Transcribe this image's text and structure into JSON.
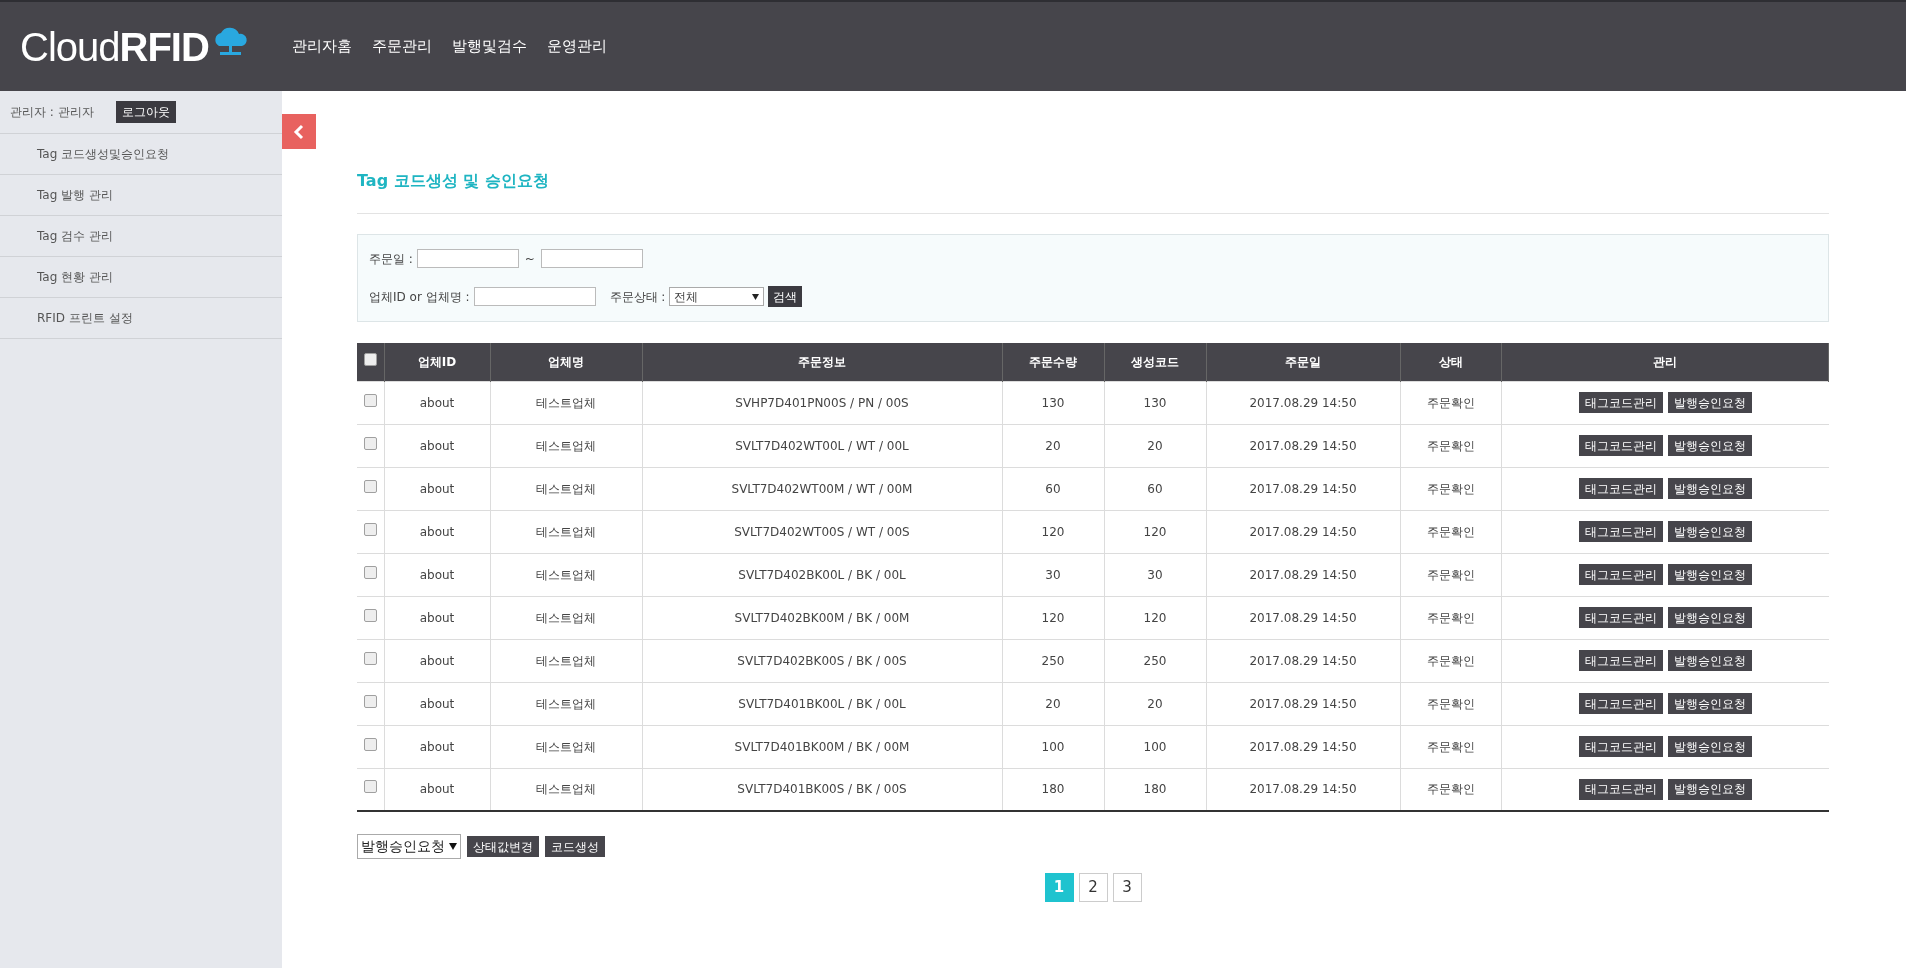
{
  "header": {
    "logo_light": "Cloud",
    "logo_bold": "RFID",
    "nav": [
      {
        "label": "관리자홈"
      },
      {
        "label": "주문관리"
      },
      {
        "label": "발행및검수"
      },
      {
        "label": "운영관리"
      }
    ]
  },
  "sidebar": {
    "user": "관리자 : 관리자",
    "logout": "로그아웃",
    "items": [
      {
        "label": "Tag 코드생성및승인요청"
      },
      {
        "label": "Tag 발행 관리"
      },
      {
        "label": "Tag 검수 관리"
      },
      {
        "label": "Tag 현황 관리"
      },
      {
        "label": "RFID 프린트 설정"
      }
    ]
  },
  "page_title": "Tag 코드생성 및 승인요청",
  "filters": {
    "date_label": "주문일 :",
    "date_separator": "~",
    "company_label": "업체ID or 업체명 :",
    "status_label": "주문상태 :",
    "status_value": "전체",
    "search_button": "검색"
  },
  "table": {
    "select_all_checked": false,
    "columns": [
      "업체ID",
      "업체명",
      "주문정보",
      "주문수량",
      "생성코드",
      "주문일",
      "상태",
      "관리"
    ],
    "rows": [
      {
        "checked": false,
        "cells": [
          "about",
          "테스트업체",
          "SVHP7D401PN00S / PN / 00S",
          "130",
          "130",
          "2017.08.29 14:50",
          "주문확인"
        ],
        "buttons": [
          "태그코드관리",
          "발행승인요청"
        ]
      },
      {
        "checked": false,
        "cells": [
          "about",
          "테스트업체",
          "SVLT7D402WT00L / WT / 00L",
          "20",
          "20",
          "2017.08.29 14:50",
          "주문확인"
        ],
        "buttons": [
          "태그코드관리",
          "발행승인요청"
        ]
      },
      {
        "checked": false,
        "cells": [
          "about",
          "테스트업체",
          "SVLT7D402WT00M / WT / 00M",
          "60",
          "60",
          "2017.08.29 14:50",
          "주문확인"
        ],
        "buttons": [
          "태그코드관리",
          "발행승인요청"
        ]
      },
      {
        "checked": false,
        "cells": [
          "about",
          "테스트업체",
          "SVLT7D402WT00S / WT / 00S",
          "120",
          "120",
          "2017.08.29 14:50",
          "주문확인"
        ],
        "buttons": [
          "태그코드관리",
          "발행승인요청"
        ]
      },
      {
        "checked": false,
        "cells": [
          "about",
          "테스트업체",
          "SVLT7D402BK00L / BK / 00L",
          "30",
          "30",
          "2017.08.29 14:50",
          "주문확인"
        ],
        "buttons": [
          "태그코드관리",
          "발행승인요청"
        ]
      },
      {
        "checked": false,
        "cells": [
          "about",
          "테스트업체",
          "SVLT7D402BK00M / BK / 00M",
          "120",
          "120",
          "2017.08.29 14:50",
          "주문확인"
        ],
        "buttons": [
          "태그코드관리",
          "발행승인요청"
        ]
      },
      {
        "checked": false,
        "cells": [
          "about",
          "테스트업체",
          "SVLT7D402BK00S / BK / 00S",
          "250",
          "250",
          "2017.08.29 14:50",
          "주문확인"
        ],
        "buttons": [
          "태그코드관리",
          "발행승인요청"
        ]
      },
      {
        "checked": false,
        "cells": [
          "about",
          "테스트업체",
          "SVLT7D401BK00L / BK / 00L",
          "20",
          "20",
          "2017.08.29 14:50",
          "주문확인"
        ],
        "buttons": [
          "태그코드관리",
          "발행승인요청"
        ]
      },
      {
        "checked": false,
        "cells": [
          "about",
          "테스트업체",
          "SVLT7D401BK00M / BK / 00M",
          "100",
          "100",
          "2017.08.29 14:50",
          "주문확인"
        ],
        "buttons": [
          "태그코드관리",
          "발행승인요청"
        ]
      },
      {
        "checked": false,
        "cells": [
          "about",
          "테스트업체",
          "SVLT7D401BK00S / BK / 00S",
          "180",
          "180",
          "2017.08.29 14:50",
          "주문확인"
        ],
        "buttons": [
          "태그코드관리",
          "발행승인요청"
        ]
      }
    ]
  },
  "bulk": {
    "select_value": "발행승인요청",
    "buttons": [
      "상태값변경",
      "코드생성"
    ]
  },
  "pagination": [
    {
      "label": "1",
      "selected": true
    },
    {
      "label": "2",
      "selected": false
    },
    {
      "label": "3",
      "selected": false
    }
  ]
}
